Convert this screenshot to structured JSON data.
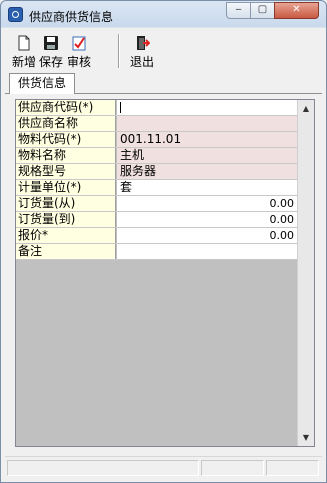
{
  "window": {
    "title": "供应商供货信息",
    "icon": "app-window-icon"
  },
  "titlebar_buttons": {
    "minimize": "‒",
    "maximize": "▢",
    "close": "✕"
  },
  "toolbar": [
    {
      "label": "新增",
      "icon": "new-document-icon"
    },
    {
      "label": "保存",
      "icon": "floppy-disk-icon"
    },
    {
      "label": "审核",
      "icon": "approve-check-icon"
    },
    {
      "label": "退出",
      "icon": "exit-door-icon"
    }
  ],
  "tabs": [
    {
      "label": "供货信息",
      "active": true
    }
  ],
  "form": {
    "rows": [
      {
        "label": "供应商代码(*)",
        "value": "",
        "style": "white",
        "focused": true
      },
      {
        "label": "供应商名称",
        "value": "",
        "style": "pink"
      },
      {
        "label": "物料代码(*)",
        "value": "001.11.01",
        "style": "pink"
      },
      {
        "label": "物料名称",
        "value": "主机",
        "style": "pink"
      },
      {
        "label": "规格型号",
        "value": "服务器",
        "style": "pink"
      },
      {
        "label": "计量单位(*)",
        "value": "套",
        "style": "white"
      },
      {
        "label": "订货量(从)",
        "value": "0.00",
        "style": "white",
        "numeric": true
      },
      {
        "label": "订货量(到)",
        "value": "0.00",
        "style": "white",
        "numeric": true
      },
      {
        "label": "报价*",
        "value": "0.00",
        "style": "white",
        "numeric": true
      },
      {
        "label": "备注",
        "value": "",
        "style": "white"
      }
    ]
  },
  "scrollbar": {
    "up": "▲",
    "down": "▼"
  },
  "colors": {
    "label_bg": "#ffffe1",
    "readonly_bg": "#f0e0e0",
    "grid_empty": "#c0c0c0"
  }
}
